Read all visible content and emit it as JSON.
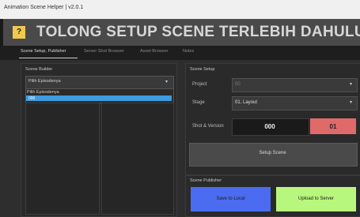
{
  "window": {
    "title": "Animation Scene Helper | v2.0.1"
  },
  "banner": {
    "help_label": "?",
    "text": "TOLONG SETUP SCENE TERLEBIH DAHULU"
  },
  "tabs": [
    {
      "label": "Scene Setup, Publisher",
      "active": true
    },
    {
      "label": "Server Shot Browser",
      "active": false
    },
    {
      "label": "Asset Browser",
      "active": false
    },
    {
      "label": "Notes",
      "active": false
    }
  ],
  "scene_builder": {
    "title": "Scene Builder",
    "episode_select": {
      "value": "Pilih Episodenya"
    },
    "dropdown_options": [
      "Pilih Episodenya",
      "000"
    ]
  },
  "scene_setup": {
    "title": "Scene Setup",
    "project": {
      "label": "Project",
      "value": "00"
    },
    "stage": {
      "label": "Stage",
      "value": "01. Layout"
    },
    "shot_version": {
      "label": "Shot & Version",
      "shot": "000",
      "version": "01"
    },
    "setup_button": "Setup Scene"
  },
  "scene_publisher": {
    "title": "Scene Publisher",
    "save_button": "Save to Local",
    "upload_button": "Upload to Server"
  },
  "colors": {
    "save": "#4b6cf0",
    "upload": "#b8f77d",
    "version_badge": "#e06a6a",
    "help": "#f2c94c",
    "selection": "#3d9be0"
  }
}
